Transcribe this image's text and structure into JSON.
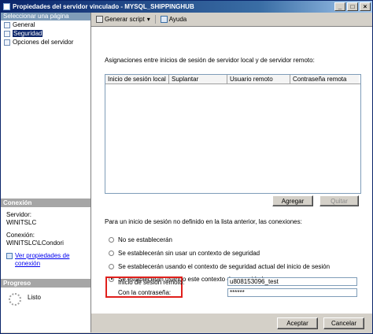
{
  "window": {
    "title": "Propiedades del servidor vinculado - MYSQL_SHIPPINGHUB",
    "buttons": [
      "_",
      "□",
      "×"
    ]
  },
  "sidebar": {
    "header": "Seleccionar una página",
    "items": [
      {
        "label": "General",
        "selected": false
      },
      {
        "label": "Seguridad",
        "selected": true
      },
      {
        "label": "Opciones del servidor",
        "selected": false
      }
    ]
  },
  "connection": {
    "header": "Conexión",
    "server_label": "Servidor:",
    "server_value": "WINITSLC",
    "conn_label": "Conexión:",
    "conn_value": "WINITSLC\\LCondori",
    "link_line1": "Ver propiedades de",
    "link_line2": "conexión"
  },
  "progress": {
    "header": "Progreso",
    "status": "Listo"
  },
  "toolbar": {
    "script_label": "Generar script",
    "help_label": "Ayuda",
    "dropdown_arrow": "▾"
  },
  "main": {
    "mappings_label": "Asignaciones entre inicios de sesión de servidor local y de servidor remoto:",
    "grid_columns": [
      "Inicio de sesión local",
      "Suplantar",
      "Usuario remoto",
      "Contraseña remota"
    ],
    "add_button": "Agregar",
    "remove_button": "Quitar",
    "unmapped_label": "Para un inicio de sesión no definido en la lista anterior, las conexiones:",
    "radio_options": [
      {
        "label": "No se establecerán",
        "checked": false
      },
      {
        "label": "Se establecerán sin usar un contexto de seguridad",
        "checked": false
      },
      {
        "label": "Se establecerán usando el contexto de seguridad actual del inicio de sesión",
        "checked": false
      },
      {
        "label": "Se establecerán usando este contexto de seguridad:",
        "checked": true
      }
    ],
    "remote_login_label": "Inicio de sesión remoto:",
    "remote_login_value": "u808153096_test",
    "password_label": "Con la contraseña:",
    "password_value": "******"
  },
  "footer": {
    "ok_button": "Aceptar",
    "cancel_button": "Cancelar"
  },
  "colors": {
    "title_bar": "#0a246a",
    "highlight_box": "#e0201c",
    "link": "#0000ee"
  }
}
